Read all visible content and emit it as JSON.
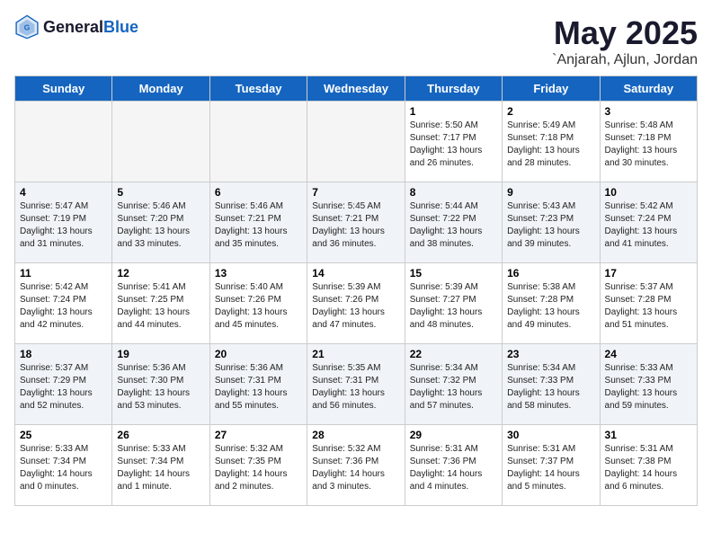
{
  "header": {
    "logo_general": "General",
    "logo_blue": "Blue",
    "title": "May 2025",
    "location": "`Anjarah, Ajlun, Jordan"
  },
  "weekdays": [
    "Sunday",
    "Monday",
    "Tuesday",
    "Wednesday",
    "Thursday",
    "Friday",
    "Saturday"
  ],
  "weeks": [
    [
      {
        "day": "",
        "detail": ""
      },
      {
        "day": "",
        "detail": ""
      },
      {
        "day": "",
        "detail": ""
      },
      {
        "day": "",
        "detail": ""
      },
      {
        "day": "1",
        "detail": "Sunrise: 5:50 AM\nSunset: 7:17 PM\nDaylight: 13 hours\nand 26 minutes."
      },
      {
        "day": "2",
        "detail": "Sunrise: 5:49 AM\nSunset: 7:18 PM\nDaylight: 13 hours\nand 28 minutes."
      },
      {
        "day": "3",
        "detail": "Sunrise: 5:48 AM\nSunset: 7:18 PM\nDaylight: 13 hours\nand 30 minutes."
      }
    ],
    [
      {
        "day": "4",
        "detail": "Sunrise: 5:47 AM\nSunset: 7:19 PM\nDaylight: 13 hours\nand 31 minutes."
      },
      {
        "day": "5",
        "detail": "Sunrise: 5:46 AM\nSunset: 7:20 PM\nDaylight: 13 hours\nand 33 minutes."
      },
      {
        "day": "6",
        "detail": "Sunrise: 5:46 AM\nSunset: 7:21 PM\nDaylight: 13 hours\nand 35 minutes."
      },
      {
        "day": "7",
        "detail": "Sunrise: 5:45 AM\nSunset: 7:21 PM\nDaylight: 13 hours\nand 36 minutes."
      },
      {
        "day": "8",
        "detail": "Sunrise: 5:44 AM\nSunset: 7:22 PM\nDaylight: 13 hours\nand 38 minutes."
      },
      {
        "day": "9",
        "detail": "Sunrise: 5:43 AM\nSunset: 7:23 PM\nDaylight: 13 hours\nand 39 minutes."
      },
      {
        "day": "10",
        "detail": "Sunrise: 5:42 AM\nSunset: 7:24 PM\nDaylight: 13 hours\nand 41 minutes."
      }
    ],
    [
      {
        "day": "11",
        "detail": "Sunrise: 5:42 AM\nSunset: 7:24 PM\nDaylight: 13 hours\nand 42 minutes."
      },
      {
        "day": "12",
        "detail": "Sunrise: 5:41 AM\nSunset: 7:25 PM\nDaylight: 13 hours\nand 44 minutes."
      },
      {
        "day": "13",
        "detail": "Sunrise: 5:40 AM\nSunset: 7:26 PM\nDaylight: 13 hours\nand 45 minutes."
      },
      {
        "day": "14",
        "detail": "Sunrise: 5:39 AM\nSunset: 7:26 PM\nDaylight: 13 hours\nand 47 minutes."
      },
      {
        "day": "15",
        "detail": "Sunrise: 5:39 AM\nSunset: 7:27 PM\nDaylight: 13 hours\nand 48 minutes."
      },
      {
        "day": "16",
        "detail": "Sunrise: 5:38 AM\nSunset: 7:28 PM\nDaylight: 13 hours\nand 49 minutes."
      },
      {
        "day": "17",
        "detail": "Sunrise: 5:37 AM\nSunset: 7:28 PM\nDaylight: 13 hours\nand 51 minutes."
      }
    ],
    [
      {
        "day": "18",
        "detail": "Sunrise: 5:37 AM\nSunset: 7:29 PM\nDaylight: 13 hours\nand 52 minutes."
      },
      {
        "day": "19",
        "detail": "Sunrise: 5:36 AM\nSunset: 7:30 PM\nDaylight: 13 hours\nand 53 minutes."
      },
      {
        "day": "20",
        "detail": "Sunrise: 5:36 AM\nSunset: 7:31 PM\nDaylight: 13 hours\nand 55 minutes."
      },
      {
        "day": "21",
        "detail": "Sunrise: 5:35 AM\nSunset: 7:31 PM\nDaylight: 13 hours\nand 56 minutes."
      },
      {
        "day": "22",
        "detail": "Sunrise: 5:34 AM\nSunset: 7:32 PM\nDaylight: 13 hours\nand 57 minutes."
      },
      {
        "day": "23",
        "detail": "Sunrise: 5:34 AM\nSunset: 7:33 PM\nDaylight: 13 hours\nand 58 minutes."
      },
      {
        "day": "24",
        "detail": "Sunrise: 5:33 AM\nSunset: 7:33 PM\nDaylight: 13 hours\nand 59 minutes."
      }
    ],
    [
      {
        "day": "25",
        "detail": "Sunrise: 5:33 AM\nSunset: 7:34 PM\nDaylight: 14 hours\nand 0 minutes."
      },
      {
        "day": "26",
        "detail": "Sunrise: 5:33 AM\nSunset: 7:34 PM\nDaylight: 14 hours\nand 1 minute."
      },
      {
        "day": "27",
        "detail": "Sunrise: 5:32 AM\nSunset: 7:35 PM\nDaylight: 14 hours\nand 2 minutes."
      },
      {
        "day": "28",
        "detail": "Sunrise: 5:32 AM\nSunset: 7:36 PM\nDaylight: 14 hours\nand 3 minutes."
      },
      {
        "day": "29",
        "detail": "Sunrise: 5:31 AM\nSunset: 7:36 PM\nDaylight: 14 hours\nand 4 minutes."
      },
      {
        "day": "30",
        "detail": "Sunrise: 5:31 AM\nSunset: 7:37 PM\nDaylight: 14 hours\nand 5 minutes."
      },
      {
        "day": "31",
        "detail": "Sunrise: 5:31 AM\nSunset: 7:38 PM\nDaylight: 14 hours\nand 6 minutes."
      }
    ]
  ]
}
